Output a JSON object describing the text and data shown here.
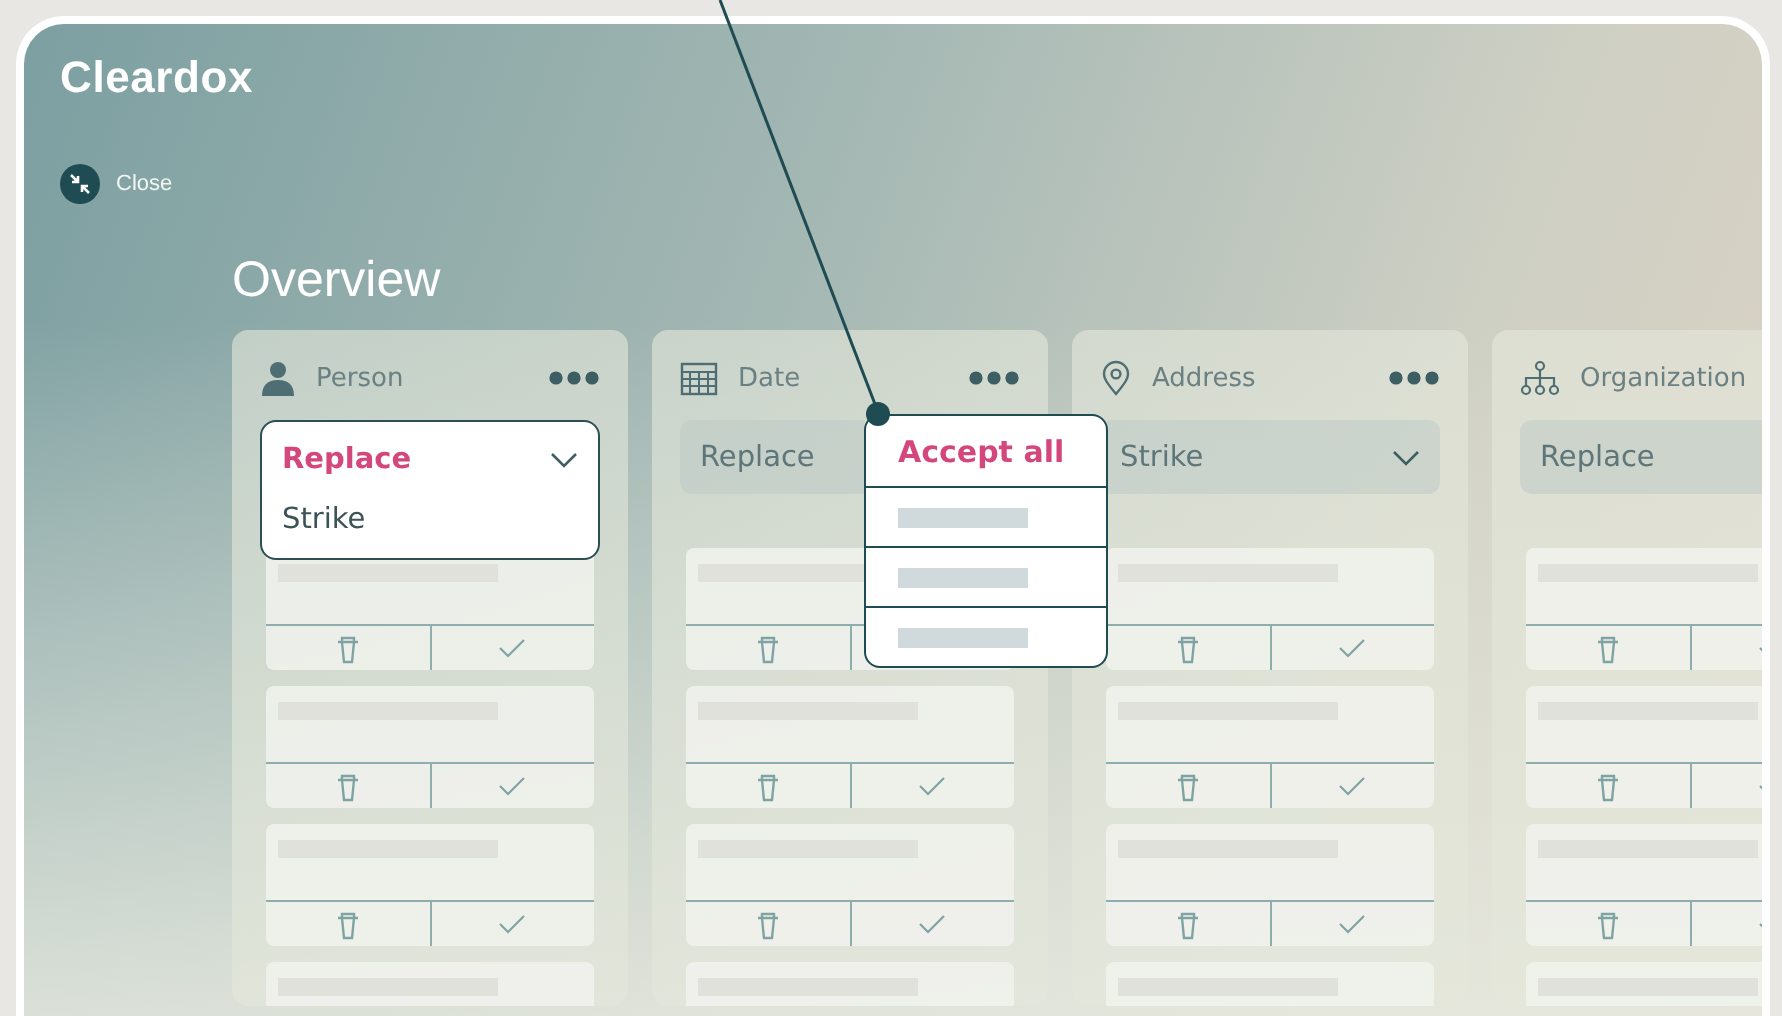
{
  "brand": {
    "logo": "Cleardox"
  },
  "close_button": {
    "label": "Close"
  },
  "title": "Overview",
  "columns": [
    {
      "name": "Person",
      "kind": "person",
      "has_menu": true,
      "dropdown": {
        "expanded": true,
        "options": [
          {
            "label": "Replace",
            "selected": true
          },
          {
            "label": "Strike",
            "selected": false
          }
        ]
      }
    },
    {
      "name": "Date",
      "kind": "calendar",
      "has_menu": true,
      "dropdown": {
        "expanded": false,
        "value": "Replace"
      },
      "menu": {
        "open": true,
        "items": [
          {
            "label": "Accept all"
          }
        ]
      }
    },
    {
      "name": "Address",
      "kind": "pin",
      "has_menu": true,
      "dropdown": {
        "expanded": false,
        "value": "Strike"
      }
    },
    {
      "name": "Organization",
      "kind": "tree",
      "has_menu": false,
      "dropdown": {
        "expanded": false,
        "value": "Replace"
      }
    }
  ]
}
